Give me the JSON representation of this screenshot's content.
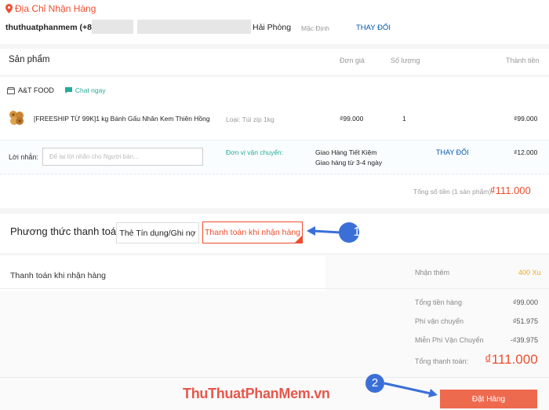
{
  "address": {
    "title": "Địa Chỉ Nhận Hàng",
    "name": "thuthuatphanmem (+84)",
    "city": "Hải Phòng",
    "default_badge": "Mặc Định",
    "change_label": "THAY ĐỔI"
  },
  "table_header": {
    "product": "Sản phẩm",
    "unit_price": "Đơn giá",
    "quantity": "Số lượng",
    "total": "Thành tiền"
  },
  "shop": {
    "name": "A&T FOOD",
    "chat_label": "Chat ngay"
  },
  "product": {
    "title": "[FREESHIP TỪ 99K]1 kg Bánh Gấu Nhân Kem Thiên Hồng",
    "variant": "Loại: Túi zip 1kg",
    "price": "₫99.000",
    "qty": "1",
    "subtotal": "₫99.000"
  },
  "note": {
    "label": "Lời nhắn:",
    "placeholder": "Để lại lời nhắn cho Người bán..."
  },
  "shipping": {
    "label": "Đơn vị vận chuyển:",
    "method": "Giao Hàng Tiết Kiệm",
    "eta": "Giao hàng từ 3-4 ngày",
    "change_label": "THAY ĐỔI",
    "fee": "₫12.000"
  },
  "order_total": {
    "label": "Tổng số tiền (1 sản phẩm):",
    "value": "₫111.000"
  },
  "payment": {
    "title": "Phương thức thanh toán",
    "option_card": "Thẻ Tín dụng/Ghi nợ",
    "option_cod": "Thanh toán khi nhận hàng",
    "selected_desc": "Thanh toán khi nhận hàng"
  },
  "summary": {
    "bonus_label": "Nhận thêm",
    "bonus_value": "400 Xu",
    "rows": [
      {
        "label": "Tổng tiền hàng",
        "value": "₫99.000"
      },
      {
        "label": "Phí vận chuyển",
        "value": "₫51.975"
      },
      {
        "label": "Miễn Phí Vận Chuyển",
        "value": "-₫39.975"
      }
    ],
    "grand_label": "Tổng thanh toán:",
    "grand_value": "₫111.000"
  },
  "place_order_label": "Đặt Hàng",
  "annotations": {
    "step1": "1",
    "step2": "2"
  },
  "watermark": "ThuThuatPhanMem.vn",
  "colors": {
    "accent": "#ee4d2d",
    "link": "#05a",
    "teal": "#26aa99",
    "annotation": "#3a6fd8"
  }
}
